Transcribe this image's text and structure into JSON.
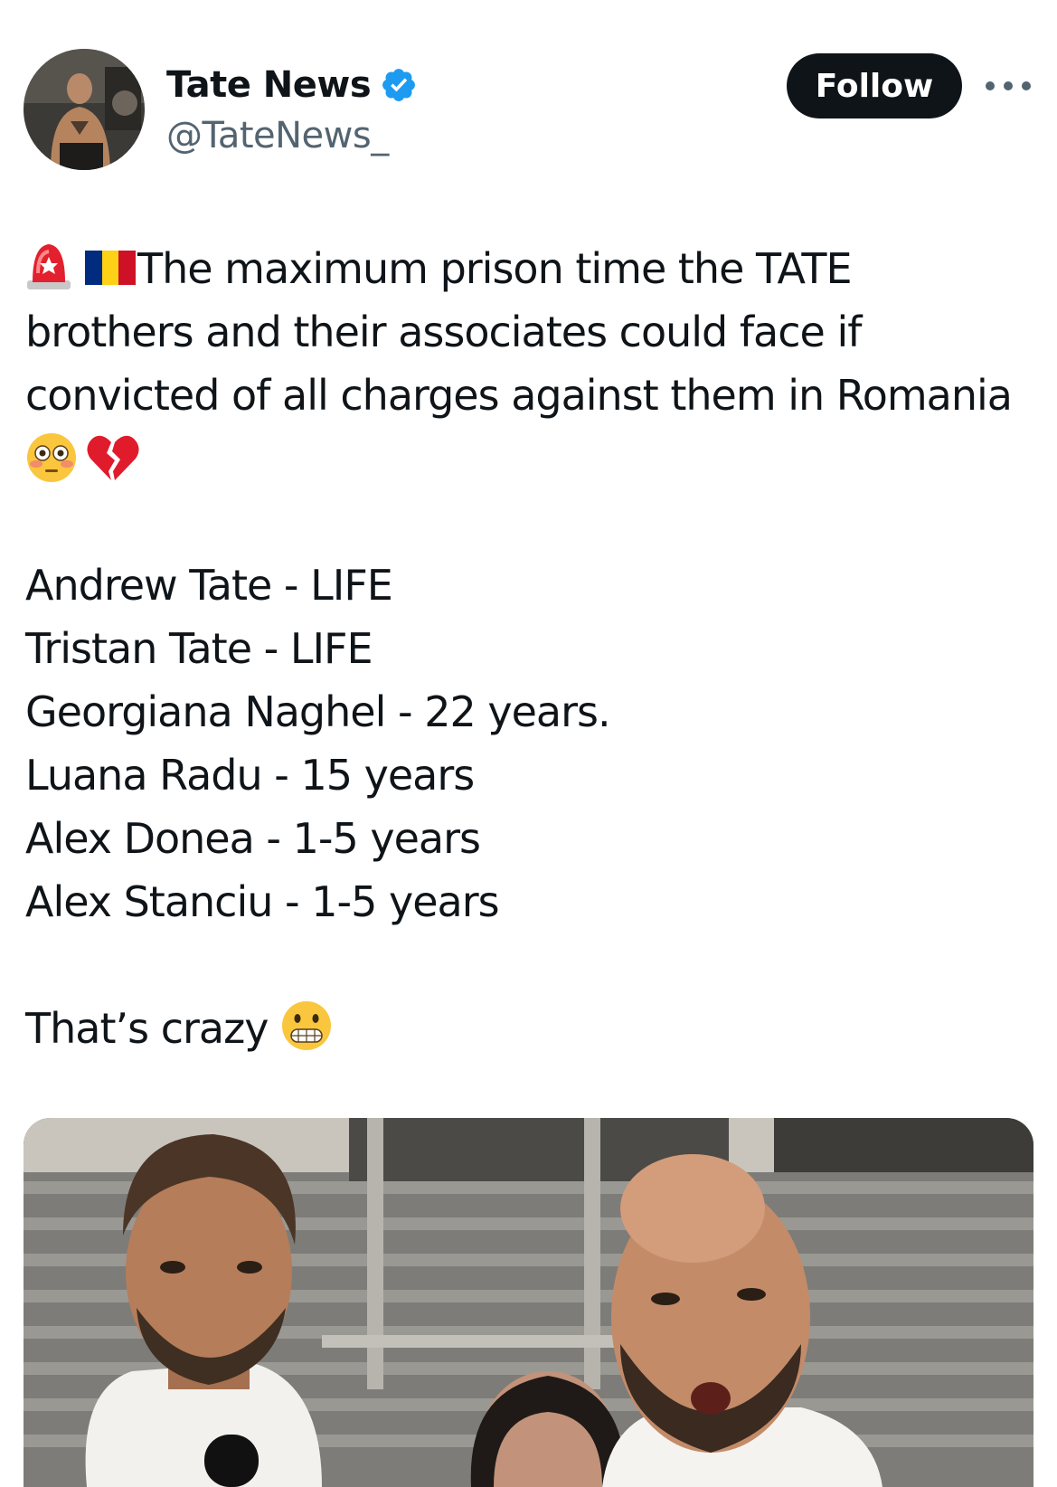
{
  "author": {
    "display_name": "Tate News",
    "handle": "@TateNews_",
    "verified_icon": "verified-badge-icon",
    "avatar_icon": "avatar"
  },
  "actions": {
    "follow_label": "Follow",
    "more_icon": "more-options-icon"
  },
  "tweet": {
    "intro_emojis": [
      "siren-emoji",
      "romania-flag-emoji"
    ],
    "lines": [
      "The maximum prison time the TATE",
      "brothers and their associates could face if",
      "convicted of all charges against them in Romania"
    ],
    "reaction_emojis": [
      "flushed-face-emoji",
      "broken-heart-emoji"
    ],
    "sentences": [
      "Andrew Tate - LIFE",
      "Tristan Tate - LIFE",
      "Georgiana Naghel - 22 years.",
      "Luana Radu - 15 years",
      "Alex Donea - 1-5 years",
      "Alex Stanciu - 1-5 years"
    ],
    "closing": "That’s crazy",
    "closing_emoji": "grimacing-face-emoji"
  },
  "media": {
    "type": "photo",
    "description_icon": "news-photo"
  },
  "colors": {
    "text": "#0f1419",
    "secondary": "#536471",
    "verified": "#1d9bf0",
    "button": "#0f1419"
  }
}
